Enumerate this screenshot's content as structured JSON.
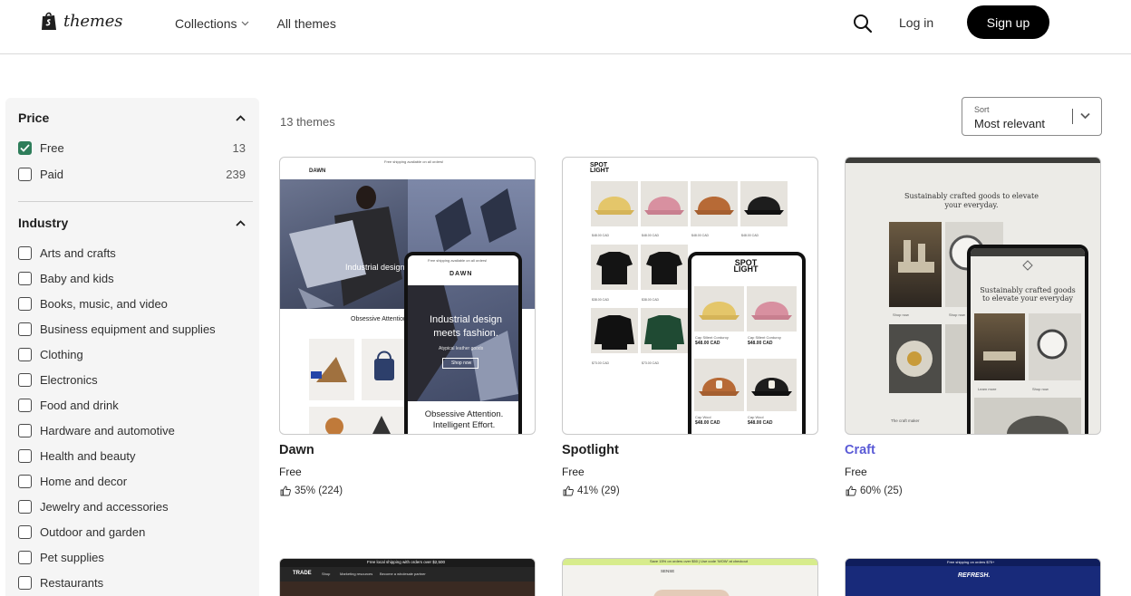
{
  "header": {
    "logo_text": "themes",
    "nav": [
      {
        "label": "Collections",
        "has_dropdown": true
      },
      {
        "label": "All themes",
        "has_dropdown": false
      }
    ],
    "login_label": "Log in",
    "signup_label": "Sign up",
    "icons": {
      "logo": "shopify-bag-icon",
      "search": "search-icon"
    }
  },
  "filters": {
    "price": {
      "title": "Price",
      "options": [
        {
          "label": "Free",
          "count": "13",
          "checked": true
        },
        {
          "label": "Paid",
          "count": "239",
          "checked": false
        }
      ]
    },
    "industry": {
      "title": "Industry",
      "options": [
        {
          "label": "Arts and crafts"
        },
        {
          "label": "Baby and kids"
        },
        {
          "label": "Books, music, and video"
        },
        {
          "label": "Business equipment and supplies"
        },
        {
          "label": "Clothing"
        },
        {
          "label": "Electronics"
        },
        {
          "label": "Food and drink"
        },
        {
          "label": "Hardware and automotive"
        },
        {
          "label": "Health and beauty"
        },
        {
          "label": "Home and decor"
        },
        {
          "label": "Jewelry and accessories"
        },
        {
          "label": "Outdoor and garden"
        },
        {
          "label": "Pet supplies"
        },
        {
          "label": "Restaurants"
        }
      ]
    }
  },
  "results": {
    "count_label": "13 themes",
    "sort": {
      "caption": "Sort",
      "value": "Most relevant"
    }
  },
  "themes": [
    {
      "name": "Dawn",
      "price": "Free",
      "rating": "35% (224)",
      "preview": {
        "brand": "DAWN",
        "announcement": "Free shipping available on all orders!",
        "hero_desktop": "Industrial design",
        "hero_mobile": "Industrial design meets fashion.",
        "hero_sub": "Atypical leather goods",
        "cta": "Shop now",
        "section_desktop": "Obsessive Attention",
        "section_mobile": "Obsessive Attention. Intelligent Effort."
      }
    },
    {
      "name": "Spotlight",
      "price": "Free",
      "rating": "41% (29)",
      "preview": {
        "brand": "SPOT LIGHT",
        "caps": [
          {
            "label": "Cap Sillent Corduroy",
            "price": "$48.00 CAD"
          },
          {
            "label": "Cap Sillent Corduroy",
            "price": "$48.00 CAD"
          },
          {
            "label": "Cap Wool",
            "price": "$48.00 CAD"
          },
          {
            "label": "Cap Wool",
            "price": "$48.00 CAD"
          }
        ],
        "desktop_prices": [
          "$48.00 CAD",
          "$48.00 CAD",
          "$48.00 CAD",
          "$48.00 CAD",
          "$38.00 CAD",
          "$38.00 CAD",
          "$73.00 CAD",
          "$73.00 CAD"
        ]
      }
    },
    {
      "name": "Craft",
      "price": "Free",
      "rating": "60% (25)",
      "highlighted": true,
      "preview": {
        "hero_desktop": "Sustainably crafted goods to elevate your everyday.",
        "hero_mobile": "Sustainably crafted goods to elevate your everyday",
        "section": "The craft maker",
        "links": [
          "Shop now",
          "Shop now",
          "Learn more",
          "Shop now"
        ]
      }
    }
  ],
  "row2": [
    {
      "announcement": "Free local shipping with orders over $2,500",
      "brand": "TRADE",
      "nav": [
        "Shop",
        "Marketing resources",
        "Become a wholesale partner"
      ]
    },
    {
      "announcement": "Save 15% on orders over $50 | Use code 'WOW' at checkout",
      "brand": "SENSE"
    },
    {
      "announcement": "Free shipping on orders $75+",
      "brand": "REFRESH."
    }
  ],
  "colors": {
    "accent_link": "#5a5ad6",
    "checkbox_checked": "#2e7d5a",
    "signup_bg": "#000000"
  }
}
